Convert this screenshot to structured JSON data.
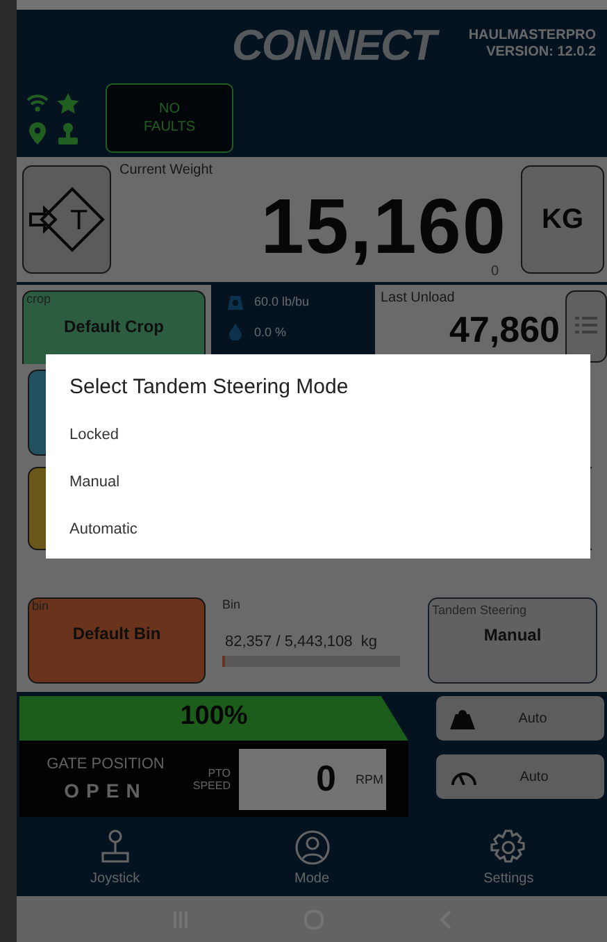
{
  "header": {
    "logo": "CONNECT",
    "app_name": "HAULMASTERPRO",
    "version": "VERSION: 12.0.2"
  },
  "status": {
    "faults": "NO FAULTS"
  },
  "weight": {
    "tare_label": "T",
    "label": "Current Weight",
    "value": "15,160",
    "sub_value": "0",
    "unit": "KG"
  },
  "crop": {
    "label": "crop",
    "name": "Default Crop",
    "test_weight": "60.0 lb/bu",
    "moisture": "0.0 %"
  },
  "last_unload": {
    "label": "Last Unload",
    "value": "47,860"
  },
  "bin": {
    "label": "bin",
    "name": "Default Bin",
    "title": "Bin",
    "amount": "82,357 / 5,443,108  kg",
    "level": 0.015
  },
  "tandem": {
    "label": "Tandem Steering",
    "value": "Manual"
  },
  "gate_fill": {
    "level": 1.0,
    "reading": "100%"
  },
  "gate": {
    "label": "GATE POSITION",
    "value": "OPEN"
  },
  "pto": {
    "label": "PTO SPEED",
    "value": "0",
    "unit": "RPM"
  },
  "auto_buttons": [
    {
      "kind": "weight",
      "label": "Auto"
    },
    {
      "kind": "gauge",
      "label": "Auto"
    }
  ],
  "nav": [
    {
      "kind": "joystick",
      "label": "Joystick"
    },
    {
      "kind": "mode",
      "label": "Mode"
    },
    {
      "kind": "settings",
      "label": "Settings"
    }
  ],
  "dialog": {
    "title": "Select Tandem Steering Mode",
    "options": [
      "Locked",
      "Manual",
      "Automatic"
    ]
  }
}
